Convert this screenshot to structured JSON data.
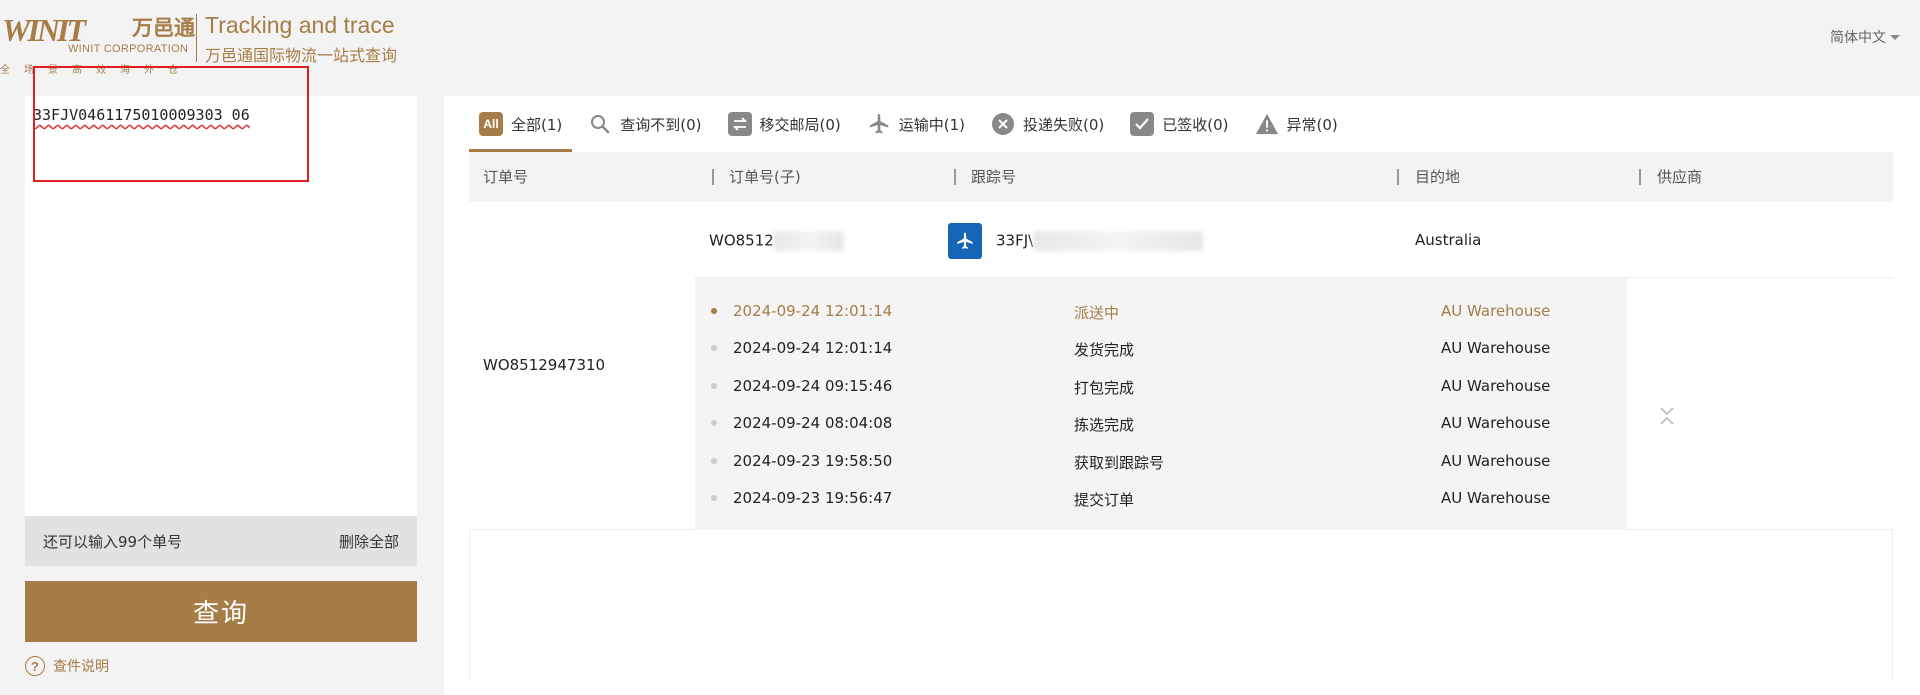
{
  "header": {
    "logo_wordmark": "WINIT",
    "logo_cn": "万邑通",
    "logo_corp": "WINIT CORPORATION",
    "logo_slogan": "全场景高效海外仓",
    "title": "Tracking and trace",
    "subtitle": "万邑通国际物流一站式查询",
    "language": "简体中文"
  },
  "left": {
    "input_value": "33FJV0461175010009303 06",
    "remaining": "还可以输入99个单号",
    "clear_all": "删除全部",
    "query_button": "查询",
    "help": "查件说明"
  },
  "tabs": [
    {
      "icon": "all-badge",
      "badge": "All",
      "label": "全部(1)"
    },
    {
      "icon": "search-icon",
      "label": "查询不到(0)"
    },
    {
      "icon": "transfer-icon",
      "label": "移交邮局(0)"
    },
    {
      "icon": "airplane-icon",
      "label": "运输中(1)"
    },
    {
      "icon": "close-circle-icon",
      "label": "投递失败(0)"
    },
    {
      "icon": "checkbox-icon",
      "label": "已签收(0)"
    },
    {
      "icon": "warning-icon",
      "label": "异常(0)"
    }
  ],
  "table": {
    "columns": [
      "订单号",
      "订单号(子)",
      "跟踪号",
      "目的地",
      "供应商"
    ],
    "order": {
      "order_no": "WO8512947310",
      "sub_order_no": "WO8512",
      "tracking_no": "33FJ\\",
      "destination": "Australia",
      "events": [
        {
          "time": "2024-09-24 12:01:14",
          "status": "派送中",
          "location": "AU Warehouse"
        },
        {
          "time": "2024-09-24 12:01:14",
          "status": "发货完成",
          "location": "AU Warehouse"
        },
        {
          "time": "2024-09-24 09:15:46",
          "status": "打包完成",
          "location": "AU Warehouse"
        },
        {
          "time": "2024-09-24 08:04:08",
          "status": "拣选完成",
          "location": "AU Warehouse"
        },
        {
          "time": "2024-09-23 19:58:50",
          "status": "获取到跟踪号",
          "location": "AU Warehouse"
        },
        {
          "time": "2024-09-23 19:56:47",
          "status": "提交订单",
          "location": "AU Warehouse"
        }
      ]
    }
  },
  "colors": {
    "accent": "#a67c47",
    "plane_badge": "#1666b8",
    "highlight": "#e02020"
  }
}
